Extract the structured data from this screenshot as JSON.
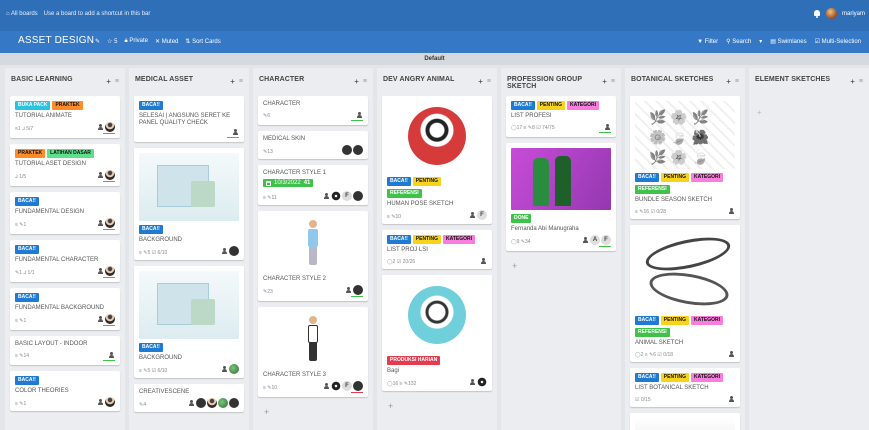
{
  "topbar": {
    "boards_link": "All boards",
    "hint": "Use a board to add a shortcut in this bar",
    "username": "mariyam"
  },
  "board": {
    "title": "ASSET DESIGN",
    "stars": "5",
    "visibility": "Private",
    "muted": "Muted",
    "sort": "Sort Cards",
    "filter": "Filter",
    "search": "Search",
    "swimlanes": "Swimlanes",
    "multi": "Multi-Selection"
  },
  "swimlane": "Default",
  "colors": {
    "topbar": "#2f6fb8",
    "boardbar": "#3478c6",
    "label_blue": "#1f7ad1",
    "label_yellow": "#f7d31c",
    "label_pink": "#f87ddc",
    "label_green": "#3ec24a",
    "label_orange": "#ff8c28",
    "label_cyan": "#28c4e0",
    "label_red": "#e43b4e"
  },
  "lists": [
    {
      "title": "BASIC LEARNING",
      "cards": [
        {
          "labels": [
            {
              "t": "BUKA PACK",
              "c": "cyan"
            },
            {
              "t": "PRAKTEK",
              "c": "orange"
            }
          ],
          "title": "TUTORIAL ANIMATE",
          "badges": "≡1  ⅃ 5/7"
        },
        {
          "labels": [
            {
              "t": "PRAKTEK",
              "c": "orange"
            },
            {
              "t": "LATIHAN DASAR",
              "c": "lime"
            }
          ],
          "title": "TUTORIAL ASET DESIGN",
          "badges": "⅃ 1/5"
        },
        {
          "labels": [
            {
              "t": "BACA!!",
              "c": "blue"
            }
          ],
          "title": "FUNDAMENTAL DESIGN",
          "badges": "≡  ✎1"
        },
        {
          "labels": [
            {
              "t": "BACA!!",
              "c": "blue"
            }
          ],
          "title": "FUNDAMENTAL CHARACTER",
          "badges": "✎1  ⅃ 1/1"
        },
        {
          "labels": [
            {
              "t": "BACA!!",
              "c": "blue"
            }
          ],
          "title": "FUNDAMENTAL BACKGROUND",
          "badges": "≡  ✎1"
        },
        {
          "labels": [],
          "title": "BASIC LAYOUT - INDOOR",
          "badges": "≡  ✎14"
        },
        {
          "labels": [
            {
              "t": "BACA!!",
              "c": "blue"
            }
          ],
          "title": "COLOR THEORIES",
          "badges": "≡  ✎1"
        }
      ]
    },
    {
      "title": "MEDICAL ASSET",
      "cards": [
        {
          "labels": [
            {
              "t": "BACA!!",
              "c": "blue"
            }
          ],
          "title": "SELESAI | ANGSUNG SERET KE PANEL QUALITY CHECK",
          "badges": ""
        },
        {
          "labels": [
            {
              "t": "BACA!!",
              "c": "blue"
            }
          ],
          "title": "BACKGROUND",
          "badges": "≡  ✎5  ☑ 6/10"
        },
        {
          "labels": [
            {
              "t": "BACA!!",
              "c": "blue"
            }
          ],
          "title": "BACKGROUND",
          "badges": "≡  ✎5  ☑ 6/10"
        },
        {
          "labels": [],
          "title": "CREATIVESCENE",
          "badges": "✎4"
        }
      ]
    },
    {
      "title": "CHARACTER",
      "cards": [
        {
          "title": "CHARACTER",
          "badges": "✎6"
        },
        {
          "title": "MEDICAL SKIN",
          "badges": "✎13"
        },
        {
          "title": "CHARACTER STYLE 1",
          "date": "10/3/2022",
          "count": "41",
          "badges": "≡  ✎11"
        },
        {
          "title": "CHARACTER STYLE 2",
          "badges": "✎23"
        },
        {
          "title": "CHARACTER STYLE 3",
          "badges": "≡  ✎10"
        }
      ]
    },
    {
      "title": "DEV ANGRY ANIMAL",
      "cards": [
        {
          "labels": [
            {
              "t": "BACA!!",
              "c": "blue"
            },
            {
              "t": "PENTING",
              "c": "yellow"
            }
          ],
          "labels2": [
            {
              "t": "REFERENSI",
              "c": "green"
            }
          ],
          "title": "HUMAN POSE SKETCH",
          "badges": "≡  ✎10"
        },
        {
          "labels": [
            {
              "t": "BACA!!",
              "c": "blue"
            },
            {
              "t": "PENTING",
              "c": "yellow"
            },
            {
              "t": "KATEGORI",
              "c": "pink"
            }
          ],
          "title": "LIST PROJ LSI",
          "badges": "◯2  ☑ 20/26"
        },
        {
          "labels": [
            {
              "t": "PRODUKSI HARIAN",
              "c": "red"
            }
          ],
          "title": "Bagi",
          "badges": "◯16  ≡  ✎132"
        }
      ]
    },
    {
      "title": "PROFESSION GROUP SKETCH",
      "cards": [
        {
          "labels": [
            {
              "t": "BACA!!",
              "c": "blue"
            },
            {
              "t": "PENTING",
              "c": "yellow"
            },
            {
              "t": "KATEGORI",
              "c": "pink"
            }
          ],
          "title": "LIST PROFESI",
          "badges": "◯17  ≡  ✎8  ☑ 74/75"
        },
        {
          "labels": [
            {
              "t": "DONE",
              "c": "green"
            }
          ],
          "title": "Fernanda Abi Manugraha",
          "badges": "◯9  ✎34"
        }
      ]
    },
    {
      "title": "BOTANICAL SKETCHES",
      "cards": [
        {
          "labels": [
            {
              "t": "BACA!!",
              "c": "blue"
            },
            {
              "t": "PENTING",
              "c": "yellow"
            },
            {
              "t": "KATEGORI",
              "c": "pink"
            }
          ],
          "labels2": [
            {
              "t": "REFERENSI",
              "c": "green"
            }
          ],
          "title": "BUNDLE SEASON SKETCH",
          "badges": "≡  ✎16  ☑ 0/28"
        },
        {
          "labels": [
            {
              "t": "BACA!!",
              "c": "blue"
            },
            {
              "t": "PENTING",
              "c": "yellow"
            },
            {
              "t": "KATEGORI",
              "c": "pink"
            }
          ],
          "labels2": [
            {
              "t": "REFERENSI",
              "c": "green"
            }
          ],
          "title": "ANIMAL SKETCH",
          "badges": "◯2  ≡  ✎6  ☑ 0/18"
        },
        {
          "labels": [
            {
              "t": "BACA!!",
              "c": "blue"
            },
            {
              "t": "PENTING",
              "c": "yellow"
            },
            {
              "t": "KATEGORI",
              "c": "pink"
            }
          ],
          "title": "LIST BOTANICAL SKETCH",
          "badges": "☑ 0/15"
        }
      ]
    },
    {
      "title": "ELEMENT SKETCHES",
      "cards": []
    }
  ],
  "member_letters": {
    "f": "F",
    "a": "A"
  }
}
